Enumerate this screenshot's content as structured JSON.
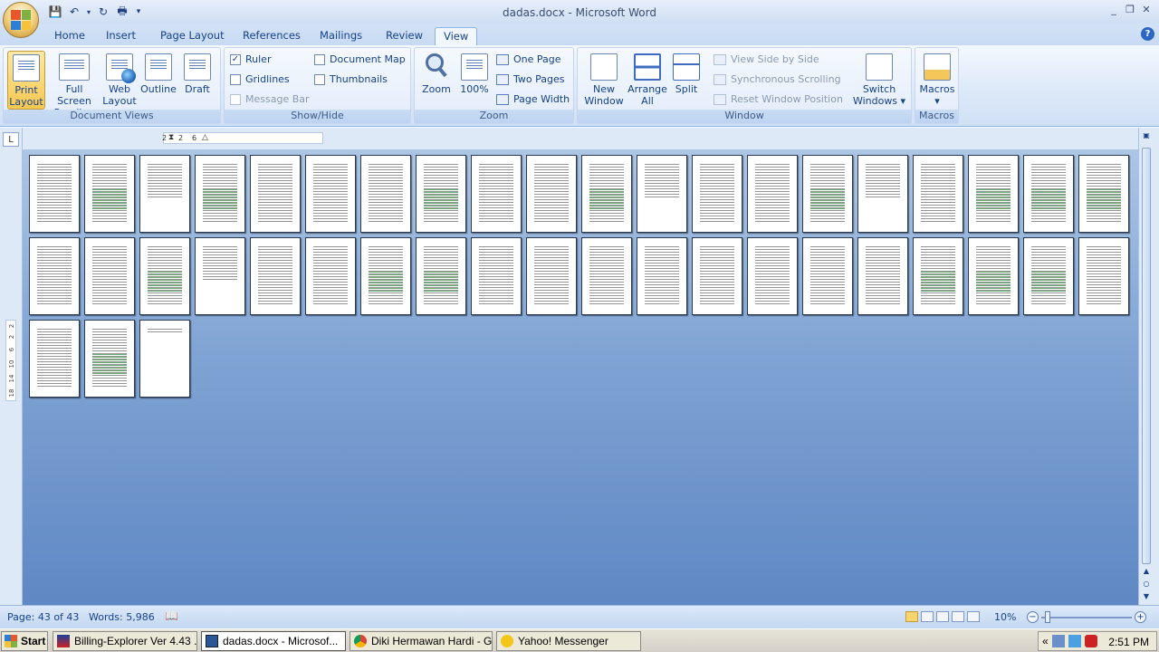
{
  "window": {
    "title": "dadas.docx - Microsoft Word",
    "minimize": "_",
    "restore": "❐",
    "close": "✕"
  },
  "qat": {
    "save_icon": "💾",
    "undo_icon": "↶",
    "redo_icon": "↻",
    "print_icon": "🖶",
    "more_icon": "▾"
  },
  "tabs": [
    {
      "label": "Home"
    },
    {
      "label": "Insert"
    },
    {
      "label": "Page Layout"
    },
    {
      "label": "References"
    },
    {
      "label": "Mailings"
    },
    {
      "label": "Review"
    },
    {
      "label": "View"
    }
  ],
  "help_label": "?",
  "ribbon": {
    "document_views": {
      "name": "Document Views",
      "print_layout": {
        "l1": "Print",
        "l2": "Layout"
      },
      "full_screen": {
        "l1": "Full Screen",
        "l2": "Reading"
      },
      "web_layout": {
        "l1": "Web",
        "l2": "Layout"
      },
      "outline": "Outline",
      "draft": "Draft"
    },
    "show_hide": {
      "name": "Show/Hide",
      "ruler": "Ruler",
      "gridlines": "Gridlines",
      "message_bar": "Message Bar",
      "document_map": "Document Map",
      "thumbnails": "Thumbnails",
      "check": "✓"
    },
    "zoom": {
      "name": "Zoom",
      "zoom": "Zoom",
      "hundred": "100%",
      "one_page": "One Page",
      "two_pages": "Two Pages",
      "page_width": "Page Width"
    },
    "window": {
      "name": "Window",
      "new_window": {
        "l1": "New",
        "l2": "Window"
      },
      "arrange_all": {
        "l1": "Arrange",
        "l2": "All"
      },
      "split": "Split",
      "view_side_by_side": "View Side by Side",
      "sync_scrolling": "Synchronous Scrolling",
      "reset_position": "Reset Window Position",
      "switch_windows": {
        "l1": "Switch",
        "l2": "Windows ▾"
      }
    },
    "macros": {
      "name": "Macros",
      "macros": {
        "l1": "Macros",
        "l2": "▾"
      }
    }
  },
  "ruler": {
    "tab_selector": "L",
    "h_marks": [
      "2",
      "2",
      "6"
    ],
    "v_marks": [
      "2",
      "2",
      "6",
      "10",
      "14",
      "18"
    ]
  },
  "document": {
    "rows": [
      [
        "",
        "green",
        "short",
        "green",
        "",
        "",
        "",
        "green",
        "",
        "",
        "green",
        "short",
        "",
        "",
        "green",
        "short",
        "",
        "green",
        "green",
        "green"
      ],
      [
        "",
        "",
        "green",
        "short",
        "",
        "",
        "green",
        "green",
        "",
        "",
        "",
        "",
        "",
        "",
        "",
        "",
        "green",
        "green",
        "green",
        ""
      ],
      [
        "",
        "green",
        "blank"
      ]
    ]
  },
  "status": {
    "page": "Page: 43 of 43",
    "words": "Words: 5,986",
    "proofing_icon": "📖",
    "zoom": "10%",
    "zoom_out": "−",
    "zoom_in": "+"
  },
  "taskbar": {
    "start": "Start",
    "tasks": [
      {
        "label": "Billing-Explorer Ver 4.43 ..."
      },
      {
        "label": "dadas.docx - Microsof..."
      },
      {
        "label": "Diki Hermawan Hardi - G..."
      },
      {
        "label": "Yahoo! Messenger"
      }
    ],
    "tray_chevron": "«",
    "clock": "2:51 PM"
  }
}
